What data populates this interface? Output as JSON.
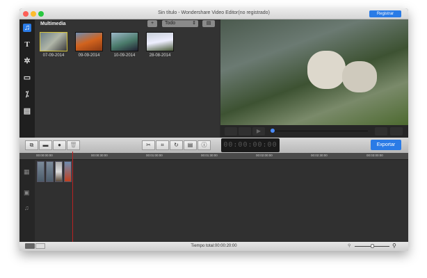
{
  "window": {
    "title": "Sin título - Wondershare Video Editor(no registrado)",
    "register_label": "Registrar"
  },
  "media": {
    "header": "Multimedia",
    "add_label": "+",
    "filter": "Todo",
    "items": [
      {
        "date": "07-09-2014"
      },
      {
        "date": "09-09-2014"
      },
      {
        "date": "10-09-2014"
      },
      {
        "date": "28-08-2014"
      }
    ]
  },
  "toolbar": {
    "timecode": "00:00:00:00",
    "export_label": "Exportar"
  },
  "timeline": {
    "ruler": [
      "00:00:00:00",
      "00:00:30:00",
      "00:01:00:00",
      "00:01:30:00",
      "00:02:00:00",
      "00:02:30:00",
      "00:03:00:00"
    ]
  },
  "status": {
    "total_time": "Tiempo total:00:00:20:00"
  },
  "colors": {
    "accent": "#2a7be6",
    "selection": "#d4c23a"
  }
}
